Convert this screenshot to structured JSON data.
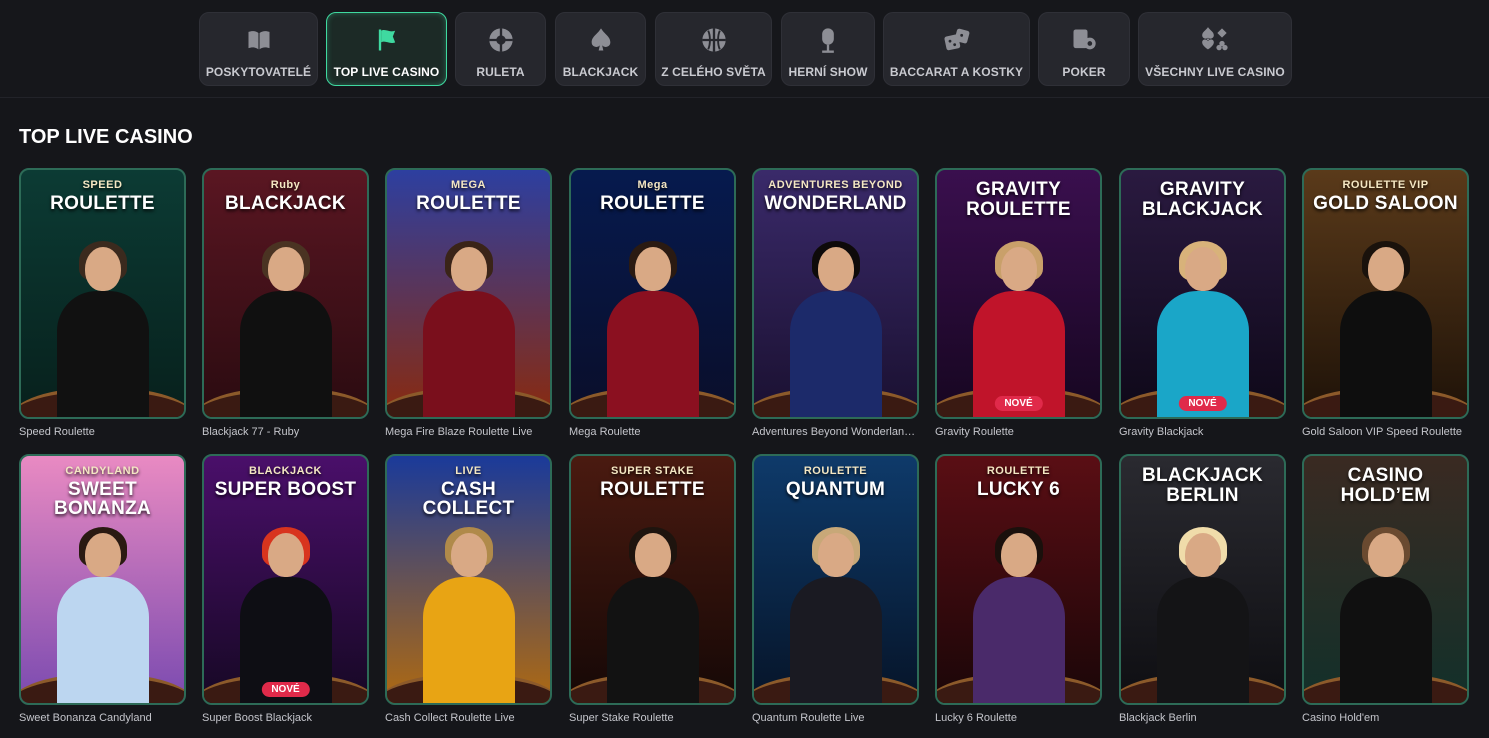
{
  "tabs": [
    {
      "label": "POSKYTOVATELÉ",
      "icon": "book-icon",
      "active": false
    },
    {
      "label": "TOP LIVE CASINO",
      "icon": "flag-icon",
      "active": true
    },
    {
      "label": "RULETA",
      "icon": "roulette-wheel-icon",
      "active": false
    },
    {
      "label": "BLACKJACK",
      "icon": "spade-icon",
      "active": false
    },
    {
      "label": "Z CELÉHO SVĚTA",
      "icon": "globe-icon",
      "active": false
    },
    {
      "label": "HERNÍ SHOW",
      "icon": "microphone-icon",
      "active": false
    },
    {
      "label": "BACCARAT A KOSTKY",
      "icon": "dice-icon",
      "active": false
    },
    {
      "label": "POKER",
      "icon": "poker-chips-icon",
      "active": false
    },
    {
      "label": "VŠECHNY LIVE CASINO",
      "icon": "card-suits-icon",
      "active": false
    }
  ],
  "section": {
    "title": "TOP LIVE CASINO"
  },
  "badge_new": "NOVÉ",
  "games": [
    {
      "name": "Speed Roulette",
      "logo": "ROULETTE",
      "logo_sub": "SPEED",
      "bg": [
        "#0c3b34",
        "#07201c"
      ],
      "outfit": "#111111",
      "hair": "#3b2a1e",
      "new": false
    },
    {
      "name": "Blackjack 77 - Ruby",
      "logo": "BLACKJACK",
      "logo_sub": "Ruby",
      "bg": [
        "#5a1622",
        "#2a0b10"
      ],
      "outfit": "#101010",
      "hair": "#4a3322",
      "new": false
    },
    {
      "name": "Mega Fire Blaze Roulette Live",
      "logo": "ROULETTE",
      "logo_sub": "MEGA",
      "bg": [
        "#2d3fa0",
        "#8a2a0e"
      ],
      "outfit": "#7a0f1c",
      "hair": "#3a2418",
      "new": false
    },
    {
      "name": "Mega Roulette",
      "logo": "ROULETTE",
      "logo_sub": "Mega",
      "bg": [
        "#061a4e",
        "#0a0e2a"
      ],
      "outfit": "#8b1020",
      "hair": "#2a1a12",
      "new": false
    },
    {
      "name": "Adventures Beyond Wonderland ...",
      "logo": "WONDERLAND",
      "logo_sub": "ADVENTURES BEYOND",
      "bg": [
        "#3a2a6a",
        "#1a1030"
      ],
      "outfit": "#1c2a6a",
      "hair": "#0e0a0a",
      "new": false
    },
    {
      "name": "Gravity Roulette",
      "logo": "GRAVITY ROULETTE",
      "logo_sub": "",
      "bg": [
        "#3a0f4e",
        "#160620"
      ],
      "outfit": "#c0142a",
      "hair": "#c9a06a",
      "new": true
    },
    {
      "name": "Gravity Blackjack",
      "logo": "GRAVITY BLACKJACK",
      "logo_sub": "",
      "bg": [
        "#2a1a40",
        "#0e0818"
      ],
      "outfit": "#1aa6c8",
      "hair": "#d8b27a",
      "new": true
    },
    {
      "name": "Gold Saloon VIP Speed Roulette",
      "logo": "GOLD SALOON",
      "logo_sub": "ROULETTE VIP",
      "bg": [
        "#5a3a1a",
        "#1e1208"
      ],
      "outfit": "#0e0e0e",
      "hair": "#1a120c",
      "new": false
    },
    {
      "name": "Sweet Bonanza Candyland",
      "logo": "SWEET BONANZA",
      "logo_sub": "CANDYLAND",
      "bg": [
        "#e98ac2",
        "#7a4ab0"
      ],
      "outfit": "#bcd6f0",
      "hair": "#2a1a12",
      "new": false
    },
    {
      "name": "Super Boost Blackjack",
      "logo": "SUPER BOOST",
      "logo_sub": "BLACKJACK",
      "bg": [
        "#4a0f6a",
        "#160824"
      ],
      "outfit": "#0e0e14",
      "hair": "#d8341e",
      "new": true
    },
    {
      "name": "Cash Collect Roulette Live",
      "logo": "CASH COLLECT",
      "logo_sub": "LIVE",
      "bg": [
        "#1a3a9a",
        "#b06a10"
      ],
      "outfit": "#e8a414",
      "hair": "#b08a4a",
      "new": false
    },
    {
      "name": "Super Stake Roulette",
      "logo": "ROULETTE",
      "logo_sub": "SUPER STAKE",
      "bg": [
        "#4a1a10",
        "#150806"
      ],
      "outfit": "#121212",
      "hair": "#1e140e",
      "new": false
    },
    {
      "name": "Quantum Roulette Live",
      "logo": "QUANTUM",
      "logo_sub": "ROULETTE",
      "bg": [
        "#0e3a6a",
        "#061428"
      ],
      "outfit": "#1a1a22",
      "hair": "#c8a878",
      "new": false
    },
    {
      "name": "Lucky 6 Roulette",
      "logo": "LUCKY 6",
      "logo_sub": "ROULETTE",
      "bg": [
        "#5a0e14",
        "#1a0608"
      ],
      "outfit": "#4a2a6a",
      "hair": "#1a100c",
      "new": false
    },
    {
      "name": "Blackjack Berlin",
      "logo": "BLACKJACK BERLIN",
      "logo_sub": "",
      "bg": [
        "#2a2a30",
        "#0e0e12"
      ],
      "outfit": "#141416",
      "hair": "#f0dcaa",
      "new": false
    },
    {
      "name": "Casino Hold'em",
      "logo": "CASINO HOLD’EM",
      "logo_sub": "",
      "bg": [
        "#3a2a22",
        "#12302a"
      ],
      "outfit": "#101010",
      "hair": "#6a4a30",
      "new": false
    }
  ]
}
